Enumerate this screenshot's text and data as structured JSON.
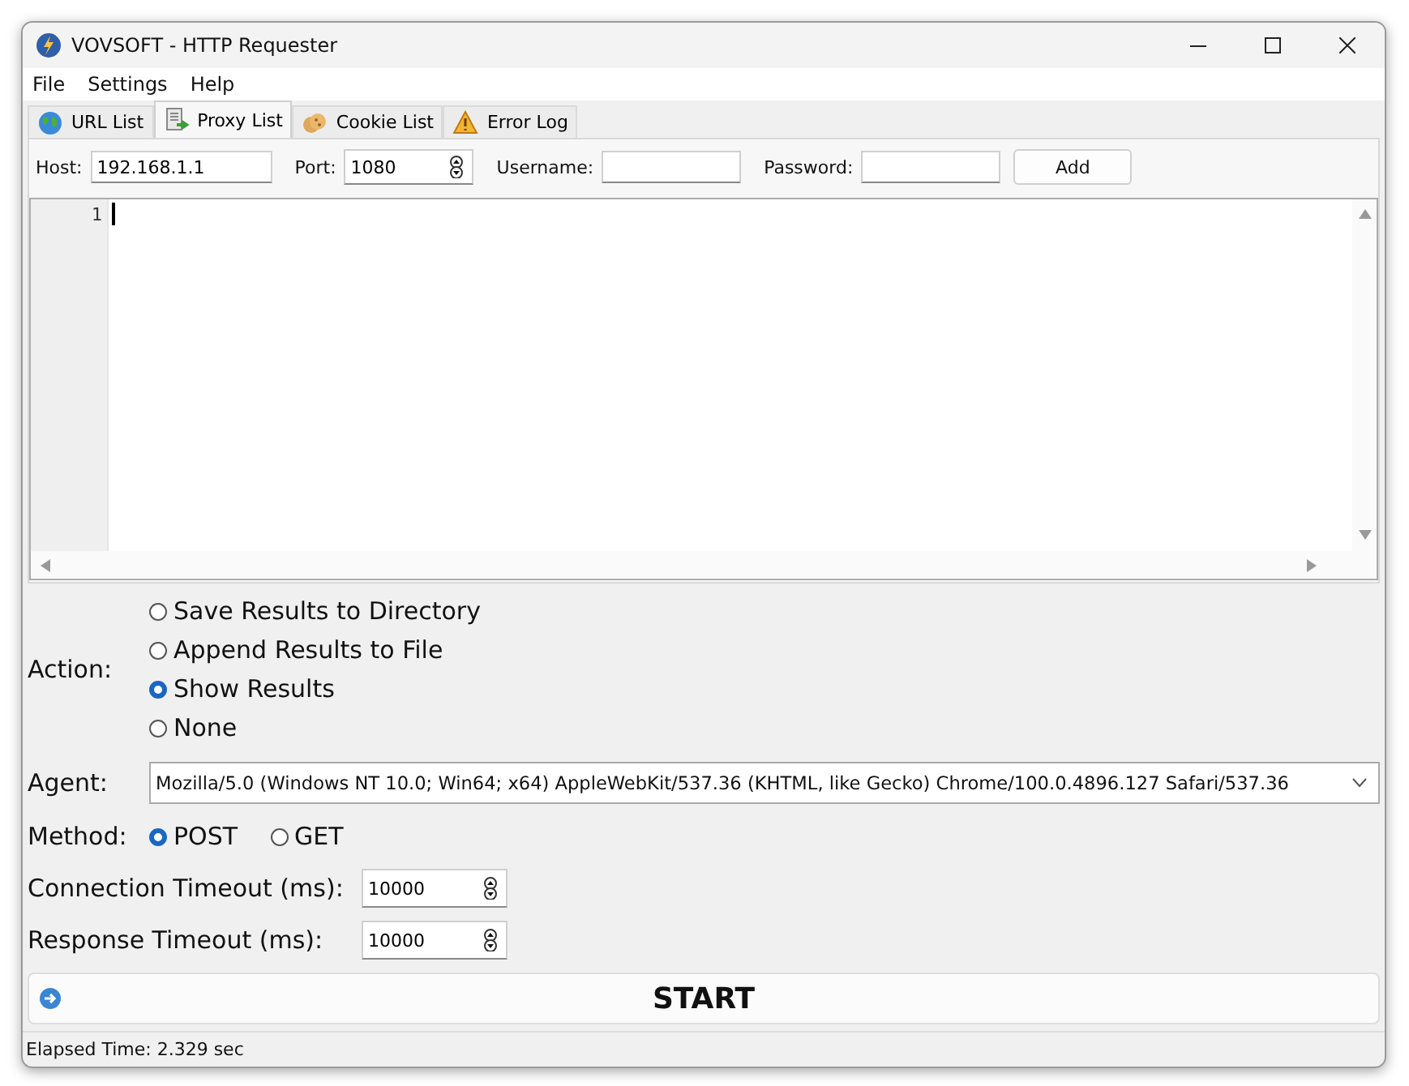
{
  "window": {
    "title": "VOVSOFT - HTTP Requester"
  },
  "menu": [
    {
      "label": "File"
    },
    {
      "label": "Settings"
    },
    {
      "label": "Help"
    }
  ],
  "tabs": [
    {
      "label": "URL List",
      "selected": false
    },
    {
      "label": "Proxy List",
      "selected": true
    },
    {
      "label": "Cookie List",
      "selected": false
    },
    {
      "label": "Error Log",
      "selected": false
    }
  ],
  "proxy_form": {
    "host": {
      "label": "Host:",
      "value": "192.168.1.1"
    },
    "port": {
      "label": "Port:",
      "value": "1080"
    },
    "username": {
      "label": "Username:"
    },
    "password": {
      "label": "Password:"
    },
    "add_button": "Add"
  },
  "editor": {
    "line_numbers": [
      "1"
    ]
  },
  "action": {
    "label": "Action:",
    "options": [
      {
        "label": "Save Results to Directory",
        "selected": false
      },
      {
        "label": "Append Results to File",
        "selected": false
      },
      {
        "label": "Show Results",
        "selected": true
      },
      {
        "label": "None",
        "selected": false
      }
    ]
  },
  "agent": {
    "label": "Agent:",
    "value": "Mozilla/5.0 (Windows NT 10.0; Win64; x64) AppleWebKit/537.36 (KHTML, like Gecko) Chrome/100.0.4896.127 Safari/537.36"
  },
  "method": {
    "label": "Method:",
    "options": [
      {
        "label": "POST",
        "selected": true
      },
      {
        "label": "GET",
        "selected": false
      }
    ]
  },
  "connection_timeout": {
    "label": "Connection Timeout (ms):",
    "value": "10000"
  },
  "response_timeout": {
    "label": "Response Timeout (ms):",
    "value": "10000"
  },
  "start_button": "START",
  "status_bar": "Elapsed Time: 2.329 sec"
}
